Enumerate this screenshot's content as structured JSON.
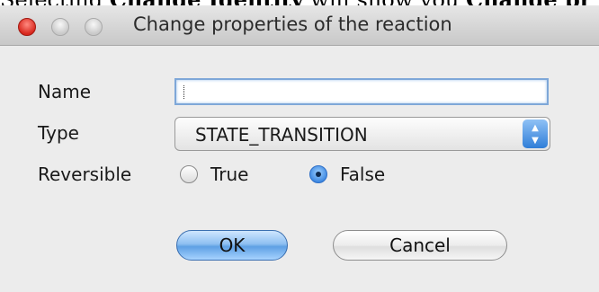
{
  "document": {
    "text_parts": [
      {
        "text": "Selecting ",
        "bold": false
      },
      {
        "text": "Change Identity",
        "bold": true
      },
      {
        "text": " will show you ",
        "bold": false
      },
      {
        "text": "Change pr",
        "bold": true
      }
    ]
  },
  "window": {
    "title": "Change properties of the reaction",
    "buttons": [
      "close-icon",
      "minimize-icon",
      "zoom-icon"
    ]
  },
  "form": {
    "name_label": "Name",
    "name_value": "",
    "type_label": "Type",
    "type_selected": "STATE_TRANSITION",
    "reversible_label": "Reversible",
    "reversible_options": [
      {
        "label": "True",
        "selected": false
      },
      {
        "label": "False",
        "selected": true
      }
    ]
  },
  "actions": {
    "ok_label": "OK",
    "cancel_label": "Cancel"
  }
}
